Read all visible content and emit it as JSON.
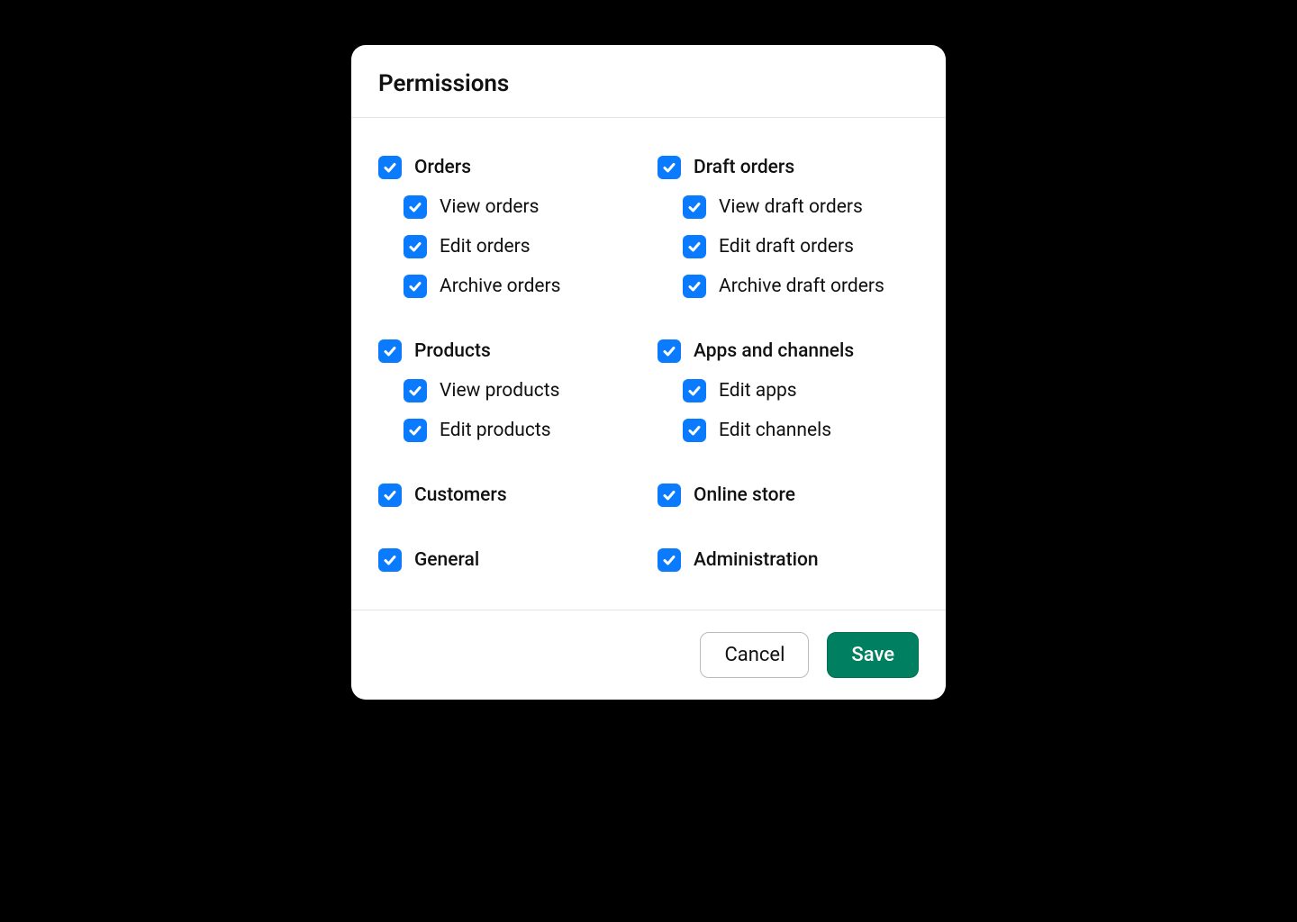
{
  "modal": {
    "title": "Permissions",
    "groups": [
      {
        "label": "Orders",
        "checked": true,
        "children": [
          {
            "label": "View orders",
            "checked": true
          },
          {
            "label": "Edit orders",
            "checked": true
          },
          {
            "label": "Archive orders",
            "checked": true
          }
        ]
      },
      {
        "label": "Draft orders",
        "checked": true,
        "children": [
          {
            "label": "View draft orders",
            "checked": true
          },
          {
            "label": "Edit draft orders",
            "checked": true
          },
          {
            "label": "Archive draft orders",
            "checked": true
          }
        ]
      },
      {
        "label": "Products",
        "checked": true,
        "children": [
          {
            "label": "View products",
            "checked": true
          },
          {
            "label": "Edit products",
            "checked": true
          }
        ]
      },
      {
        "label": "Apps and channels",
        "checked": true,
        "children": [
          {
            "label": "Edit apps",
            "checked": true
          },
          {
            "label": "Edit channels",
            "checked": true
          }
        ]
      },
      {
        "label": "Customers",
        "checked": true,
        "children": []
      },
      {
        "label": "Online store",
        "checked": true,
        "children": []
      },
      {
        "label": "General",
        "checked": true,
        "children": []
      },
      {
        "label": "Administration",
        "checked": true,
        "children": []
      }
    ],
    "buttons": {
      "cancel": "Cancel",
      "save": "Save"
    }
  },
  "colors": {
    "checkbox": "#0a7bff",
    "primaryButton": "#008060"
  }
}
